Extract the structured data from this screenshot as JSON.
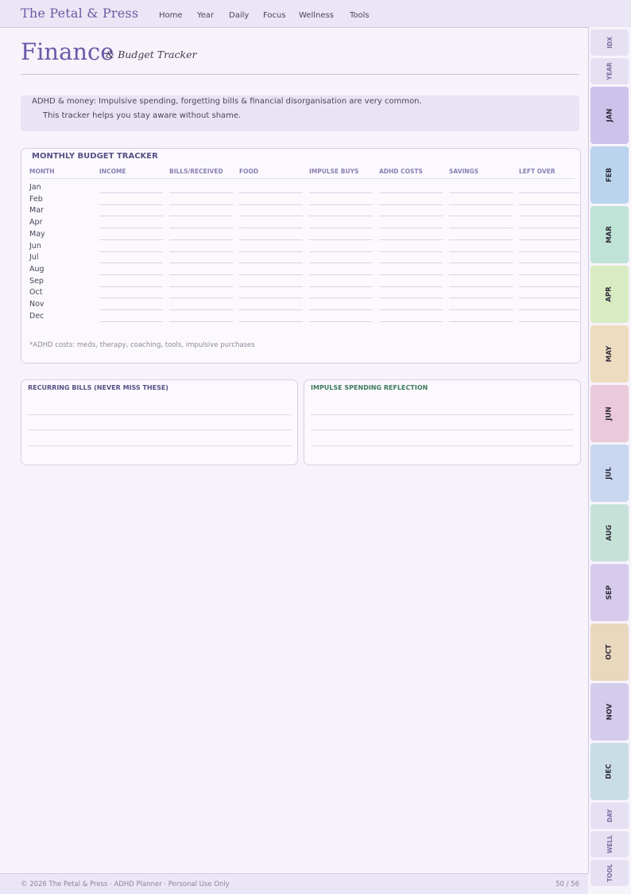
{
  "brand": "The Petal & Press",
  "nav": [
    "Home",
    "Year",
    "Daily",
    "Focus",
    "Wellness",
    "Tools"
  ],
  "page": {
    "title": "Finance",
    "subtitle": "& Budget Tracker",
    "info_line1": "ADHD & money: Impulsive spending, forgetting bills & financial disorganisation are very common.",
    "info_line2": "This tracker helps you stay aware without shame."
  },
  "budget": {
    "title": "MONTHLY BUDGET TRACKER",
    "columns": [
      "MONTH",
      "INCOME",
      "BILLS/RECEIVED",
      "FOOD",
      "IMPULSE BUYS",
      "ADHD COSTS",
      "SAVINGS",
      "LEFT OVER"
    ],
    "months": [
      "Jan",
      "Feb",
      "Mar",
      "Apr",
      "May",
      "Jun",
      "Jul",
      "Aug",
      "Sep",
      "Oct",
      "Nov",
      "Dec"
    ],
    "footnote": "*ADHD costs: meds, therapy, coaching, tools, impulsive purchases"
  },
  "bills": {
    "title": "RECURRING BILLS (NEVER MISS THESE)"
  },
  "impulse": {
    "title": "IMPULSE SPENDING REFLECTION"
  },
  "tabs": [
    {
      "label": "IDX",
      "color": "#e6e0f3",
      "small": true
    },
    {
      "label": "YEAR",
      "color": "#e6e0f3",
      "small": true
    },
    {
      "label": "JAN",
      "color": "#cdc2ea"
    },
    {
      "label": "FEB",
      "color": "#b9d4ec"
    },
    {
      "label": "MAR",
      "color": "#bfe3d6"
    },
    {
      "label": "APR",
      "color": "#d9ebc2"
    },
    {
      "label": "MAY",
      "color": "#eedcc0"
    },
    {
      "label": "JUN",
      "color": "#eac9da"
    },
    {
      "label": "JUL",
      "color": "#c8d6f0"
    },
    {
      "label": "AUG",
      "color": "#c6e2d8"
    },
    {
      "label": "SEP",
      "color": "#d6cbec"
    },
    {
      "label": "OCT",
      "color": "#e9d7be"
    },
    {
      "label": "NOV",
      "color": "#d5cbec"
    },
    {
      "label": "DEC",
      "color": "#c9dde6"
    },
    {
      "label": "DAY",
      "color": "#e6e0f3",
      "small": true
    },
    {
      "label": "WELL",
      "color": "#e6e0f3",
      "small": true
    },
    {
      "label": "TOOL",
      "color": "#e6e0f3",
      "small": true
    }
  ],
  "footer": {
    "left": "© 2026 The Petal & Press · ADHD Planner · Personal Use Only",
    "right": "50 / 56"
  }
}
